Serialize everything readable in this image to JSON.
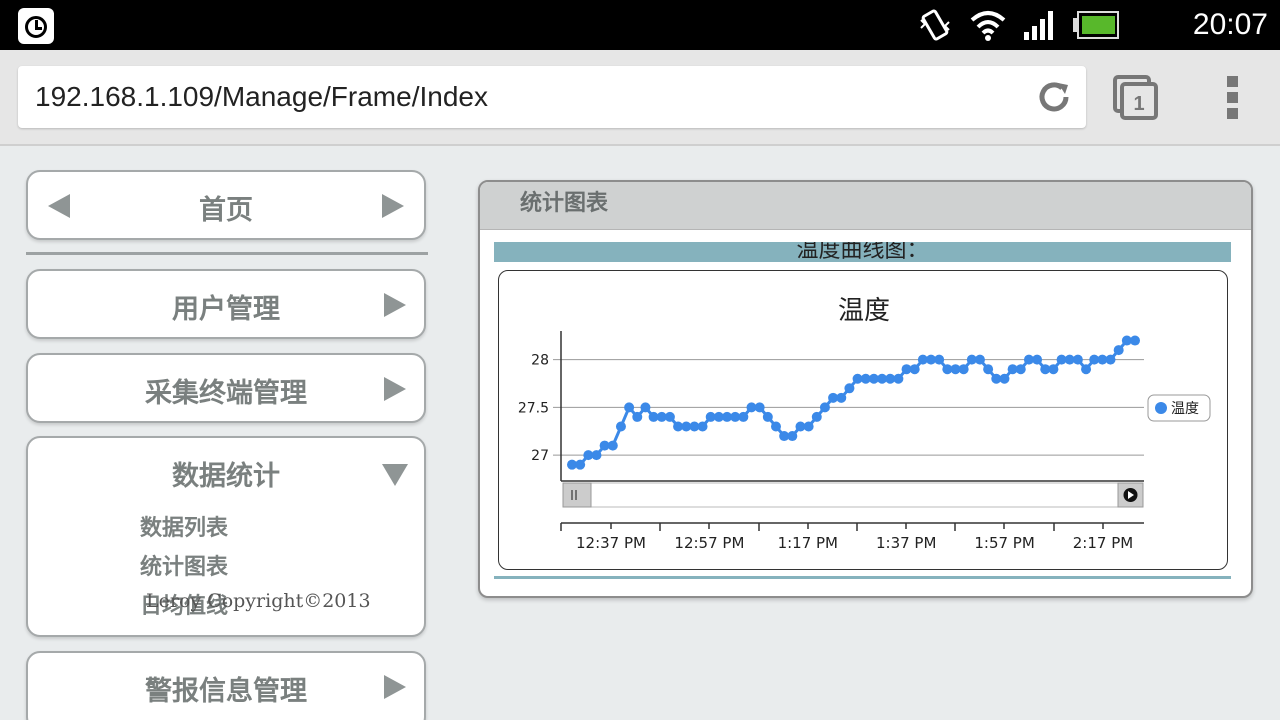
{
  "status_bar": {
    "time": "20:07",
    "icons": [
      "alarm-icon",
      "vibrate-icon",
      "wifi-icon",
      "signal-icon",
      "battery-icon"
    ]
  },
  "browser": {
    "url": "192.168.1.109/Manage/Frame/Index",
    "tab_count": "1"
  },
  "nav": {
    "home": "首页",
    "user_mgmt": "用户管理",
    "terminal_mgmt": "采集终端管理",
    "data_stats": "数据统计",
    "sub_items": [
      "数据列表",
      "统计图表",
      "日均值线"
    ],
    "copyright": "Leroy Copyright©2013",
    "alarm_mgmt": "警报信息管理"
  },
  "panel": {
    "title": "统计图表",
    "banner": "温度曲线图："
  },
  "chart_data": {
    "type": "line",
    "title": "温度",
    "series": [
      {
        "name": "温度",
        "color": "#3b89e8",
        "values": [
          26.9,
          26.9,
          27.0,
          27.0,
          27.1,
          27.1,
          27.3,
          27.5,
          27.4,
          27.5,
          27.4,
          27.4,
          27.4,
          27.3,
          27.3,
          27.3,
          27.3,
          27.4,
          27.4,
          27.4,
          27.4,
          27.4,
          27.5,
          27.5,
          27.4,
          27.3,
          27.2,
          27.2,
          27.3,
          27.3,
          27.4,
          27.5,
          27.6,
          27.6,
          27.7,
          27.8,
          27.8,
          27.8,
          27.8,
          27.8,
          27.8,
          27.9,
          27.9,
          28.0,
          28.0,
          28.0,
          27.9,
          27.9,
          27.9,
          28.0,
          28.0,
          27.9,
          27.8,
          27.8,
          27.9,
          27.9,
          28.0,
          28.0,
          27.9,
          27.9,
          28.0,
          28.0,
          28.0,
          27.9,
          28.0,
          28.0,
          28.0,
          28.1,
          28.2,
          28.2
        ]
      }
    ],
    "y_ticks": [
      "27",
      "27.5",
      "28"
    ],
    "ylim": [
      26.75,
      28.3
    ],
    "x_ticks": [
      "12:37 PM",
      "12:57 PM",
      "1:17 PM",
      "1:37 PM",
      "1:57 PM",
      "2:17 PM"
    ],
    "grid": true,
    "legend": "right"
  }
}
